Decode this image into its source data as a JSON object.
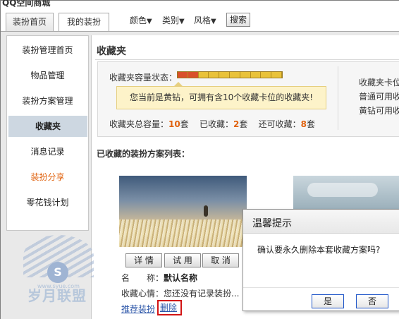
{
  "app": {
    "title": "QQ空间商城"
  },
  "top_tabs": [
    {
      "label": "装扮首页"
    },
    {
      "label": "我的装扮"
    }
  ],
  "top_nav": [
    {
      "label": "颜色",
      "arrow": "▼"
    },
    {
      "label": "类别",
      "arrow": "▼"
    },
    {
      "label": "风格",
      "arrow": "▼"
    }
  ],
  "search_label": "搜索",
  "sidebar": {
    "items": [
      {
        "label": "装扮管理首页"
      },
      {
        "label": "物品管理"
      },
      {
        "label": "装扮方案管理"
      },
      {
        "label": "收藏夹"
      },
      {
        "label": "消息记录"
      },
      {
        "label": "装扮分享"
      },
      {
        "label": "零花钱计划"
      }
    ],
    "active_index": 3,
    "highlight_color": "#e0620e"
  },
  "main": {
    "title": "收藏夹",
    "capacity_label": "收藏夹容量状态：",
    "capacity": {
      "total": 10,
      "used": 2
    },
    "tip": "您当前是黄钻，可拥有含10个收藏卡位的收藏夹!",
    "stats": {
      "total_label": "收藏夹总容量：",
      "total_value": "10",
      "total_unit": "套",
      "used_label": "已收藏：",
      "used_value": "2",
      "used_unit": "套",
      "remain_label": "还可收藏：",
      "remain_value": "8",
      "remain_unit": "套"
    },
    "right_notes": [
      "收藏夹卡位",
      "普通可用收",
      "黄钻可用收"
    ],
    "list_title": "已收藏的装扮方案列表：",
    "card": {
      "buttons": [
        "详 情",
        "试 用",
        "取 消"
      ],
      "name_label": "名　　称：",
      "name_value": "默认名称",
      "mood_label": "收藏心情：",
      "mood_value": "您还没有记录装扮...",
      "link_recommend": "推荐装扮",
      "link_delete": "删除"
    }
  },
  "dialog": {
    "title": "温馨提示",
    "message": "确认要永久删除本套收藏方案吗?",
    "yes": "是",
    "no": "否"
  },
  "watermark": {
    "brand": "岁月联盟",
    "url": "www.syue.com",
    "badge": "S"
  }
}
